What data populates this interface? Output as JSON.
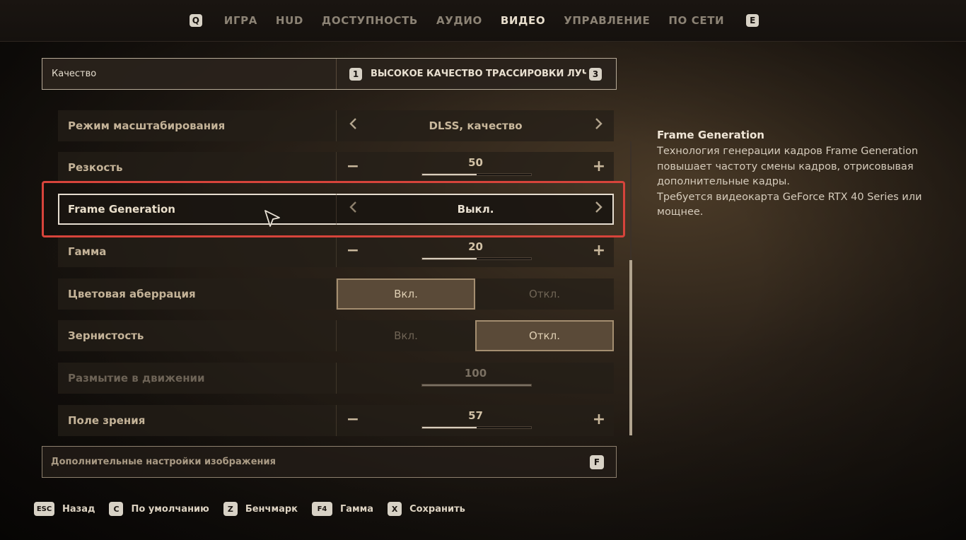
{
  "topnav": {
    "left_key": "Q",
    "right_key": "E",
    "tabs": [
      {
        "label": "ИГРА",
        "active": false
      },
      {
        "label": "HUD",
        "active": false
      },
      {
        "label": "ДОСТУПНОСТЬ",
        "active": false
      },
      {
        "label": "АУДИО",
        "active": false
      },
      {
        "label": "ВИДЕО",
        "active": true
      },
      {
        "label": "УПРАВЛЕНИЕ",
        "active": false
      },
      {
        "label": "ПО СЕТИ",
        "active": false
      }
    ]
  },
  "quality": {
    "label": "Качество",
    "prev_key": "1",
    "next_key": "3",
    "value": "ВЫСОКОЕ КАЧЕСТВО ТРАССИРОВКИ ЛУЧЕЙ"
  },
  "settings": {
    "scaling": {
      "label": "Режим масштабирования",
      "value": "DLSS, качество"
    },
    "sharpness": {
      "label": "Резкость",
      "value": "50",
      "level": 0.5
    },
    "frame_generation": {
      "label": "Frame Generation",
      "value": "Выкл."
    },
    "gamma": {
      "label": "Гамма",
      "value": "20",
      "level": 0.5
    },
    "chromatic": {
      "label": "Цветовая аберрация",
      "on": "Вкл.",
      "off": "Откл.",
      "selected": "on"
    },
    "grain": {
      "label": "Зернистость",
      "on": "Вкл.",
      "off": "Откл.",
      "selected": "off"
    },
    "motion_blur": {
      "label": "Размытие в движении",
      "value": "100",
      "level": 1.0
    },
    "fov": {
      "label": "Поле зрения",
      "value": "57",
      "level": 0.5
    }
  },
  "more": {
    "label": "Дополнительные настройки изображения",
    "key": "F"
  },
  "description": {
    "title": "Frame Generation",
    "body": "Технология генерации кадров Frame Generation повышает частоту смены кадров, отрисовывая дополнительные кадры.",
    "requirement": "Требуется видеокарта GeForce RTX 40 Series или мощнее."
  },
  "bottom_bar": [
    {
      "key": "ESC",
      "label": "Назад"
    },
    {
      "key": "C",
      "label": "По умолчанию"
    },
    {
      "key": "Z",
      "label": "Бенчмарк"
    },
    {
      "key": "F4",
      "label": "Гамма"
    },
    {
      "key": "X",
      "label": "Сохранить"
    }
  ],
  "colors": {
    "highlight": "#d7443b",
    "accent": "#e6ddd0"
  }
}
